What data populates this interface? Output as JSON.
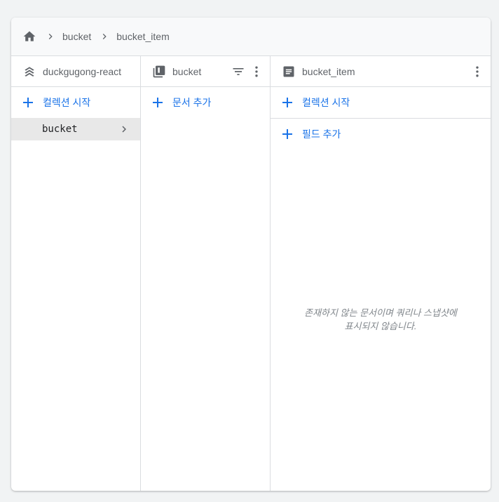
{
  "breadcrumb": {
    "items": [
      "bucket",
      "bucket_item"
    ]
  },
  "columns": {
    "root": {
      "title": "duckgugong-react",
      "action_label": "컬렉션 시작",
      "items": [
        {
          "label": "bucket"
        }
      ]
    },
    "collection": {
      "title": "bucket",
      "action_label": "문서 추가"
    },
    "document": {
      "title": "bucket_item",
      "start_collection_label": "컬렉션 시작",
      "add_field_label": "필드 추가",
      "empty_message_line1": "존재하지 않는 문서이며 쿼리나 스냅샷에",
      "empty_message_line2": "표시되지 않습니다."
    }
  },
  "colors": {
    "accent": "#1a73e8",
    "text_secondary": "#5f6368",
    "border": "#dadce0",
    "selected_bg": "#e8e8e8"
  },
  "icons": {
    "home": "home-icon",
    "separator": "chevron-right-icon",
    "root": "stacked-layers-icon",
    "collection": "collection-icon",
    "document": "document-icon",
    "filter": "filter-icon",
    "more": "more-vert-icon",
    "add": "plus-icon"
  }
}
